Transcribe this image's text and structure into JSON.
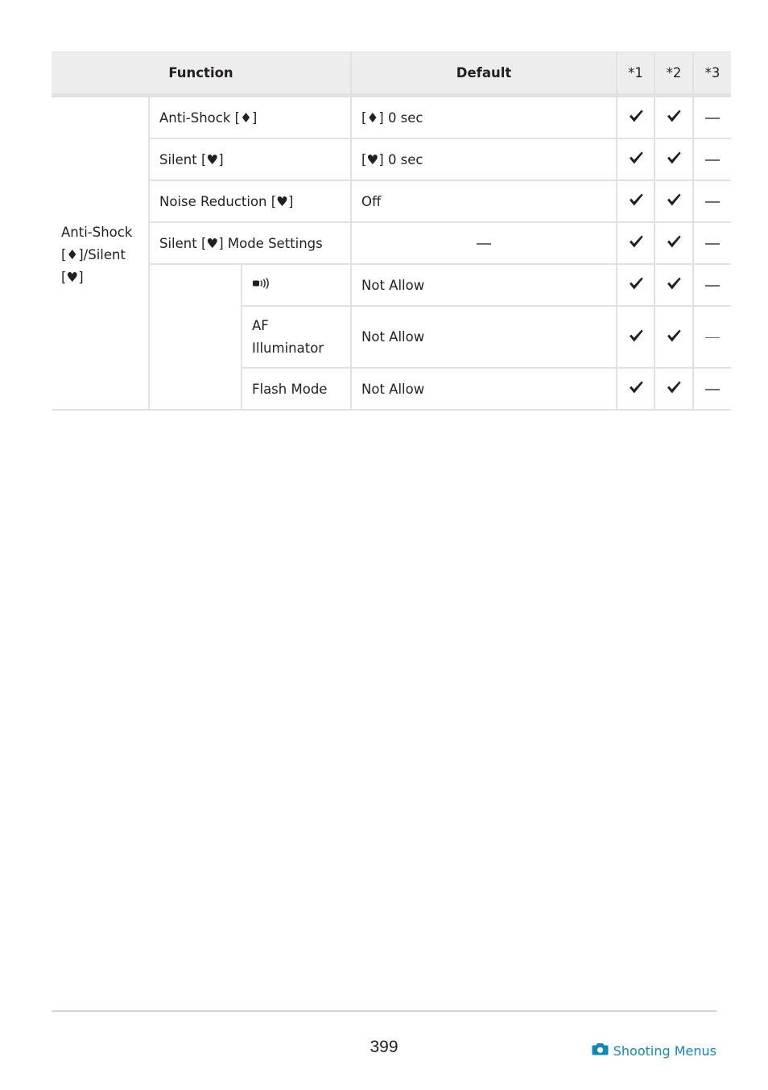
{
  "table": {
    "headers": {
      "function": "Function",
      "default": "Default",
      "col1": "*1",
      "col2": "*2",
      "col3": "*3"
    },
    "group_label": "Anti-Shock [♦]/Silent [♥]",
    "group_label_lines": [
      "Anti-Shock",
      "[♦]/Silent",
      "[♥]"
    ],
    "rows": [
      {
        "function": "Anti-Shock [♦]",
        "default": "[♦] 0 sec",
        "c1": "check",
        "c2": "check",
        "c3": "dash"
      },
      {
        "function": "Silent [♥]",
        "default": "[♥] 0 sec",
        "c1": "check",
        "c2": "check",
        "c3": "dash"
      },
      {
        "function": "Noise Reduction [♥]",
        "default": "Off",
        "c1": "check",
        "c2": "check",
        "c3": "dash"
      },
      {
        "function": "Silent [♥] Mode Settings",
        "default": "—",
        "c1": "check",
        "c2": "check",
        "c3": "dash"
      }
    ],
    "subrows": [
      {
        "function_icon": "sound-icon",
        "function": "",
        "default": "Not Allow",
        "c1": "check",
        "c2": "check",
        "c3": "dash"
      },
      {
        "function": "AF Illuminator",
        "function_lines": [
          "AF",
          "Illuminator"
        ],
        "default": "Not Allow",
        "c1": "check",
        "c2": "check",
        "c3": "dash"
      },
      {
        "function": "Flash Mode",
        "default": "Not Allow",
        "c1": "check",
        "c2": "check",
        "c3": "dash"
      }
    ]
  },
  "footer": {
    "page_number": "399",
    "section_icon": "camera-icon",
    "section_label": "Shooting Menus",
    "accent_color": "#0b8ab8"
  }
}
